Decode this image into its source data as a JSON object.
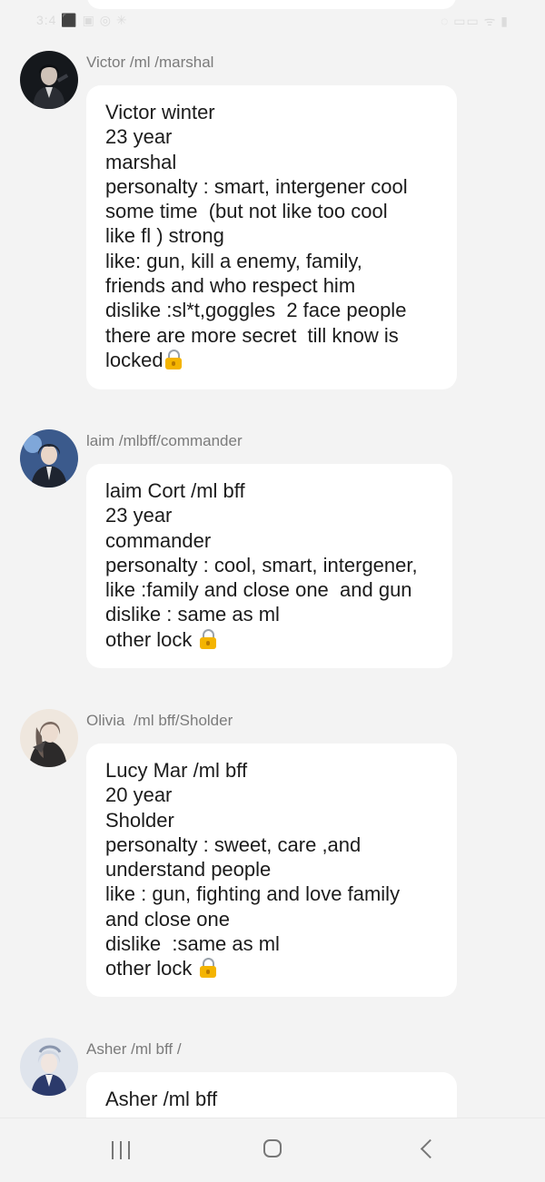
{
  "status_bar": {
    "left_text": "3:4 ⬛ ▣ ◎ ✳",
    "right_text": "◌ ▭▭ ᯤ ▮"
  },
  "messages": [
    {
      "sender": "Victor /ml /marshal",
      "lines": [
        "Victor winter",
        "23 year",
        "marshal",
        "personalty : smart, intergener cool",
        "some time  (but not like too cool",
        "like fl ) strong",
        "like: gun, kill a enemy, family,",
        "friends and who respect him",
        "dislike :sl*t,goggles  2 face people",
        "there are more secret  till know is",
        "locked"
      ],
      "lock_icon": "lock-icon"
    },
    {
      "sender": "laim /mlbff/commander",
      "lines": [
        "laim Cort /ml bff",
        "23 year",
        "commander",
        "personalty : cool, smart, intergener,",
        "like :family and close one  and gun",
        "dislike : same as ml",
        "other lock "
      ],
      "lock_icon": "lock-icon"
    },
    {
      "sender": "Olivia  /ml bff/Sholder",
      "lines": [
        "Lucy Mar /ml bff",
        "20 year",
        "Sholder",
        "personalty : sweet, care ,and",
        "understand people",
        "like : gun, fighting and love family",
        "and close one",
        "dislike  :same as ml",
        "other lock "
      ],
      "lock_icon": "lock-icon"
    },
    {
      "sender": "Asher /ml bff /",
      "lines": [
        "Asher /ml bff"
      ]
    }
  ],
  "nav_bar": {
    "recent": "recent-apps-icon",
    "home": "home-icon",
    "back": "back-icon"
  }
}
